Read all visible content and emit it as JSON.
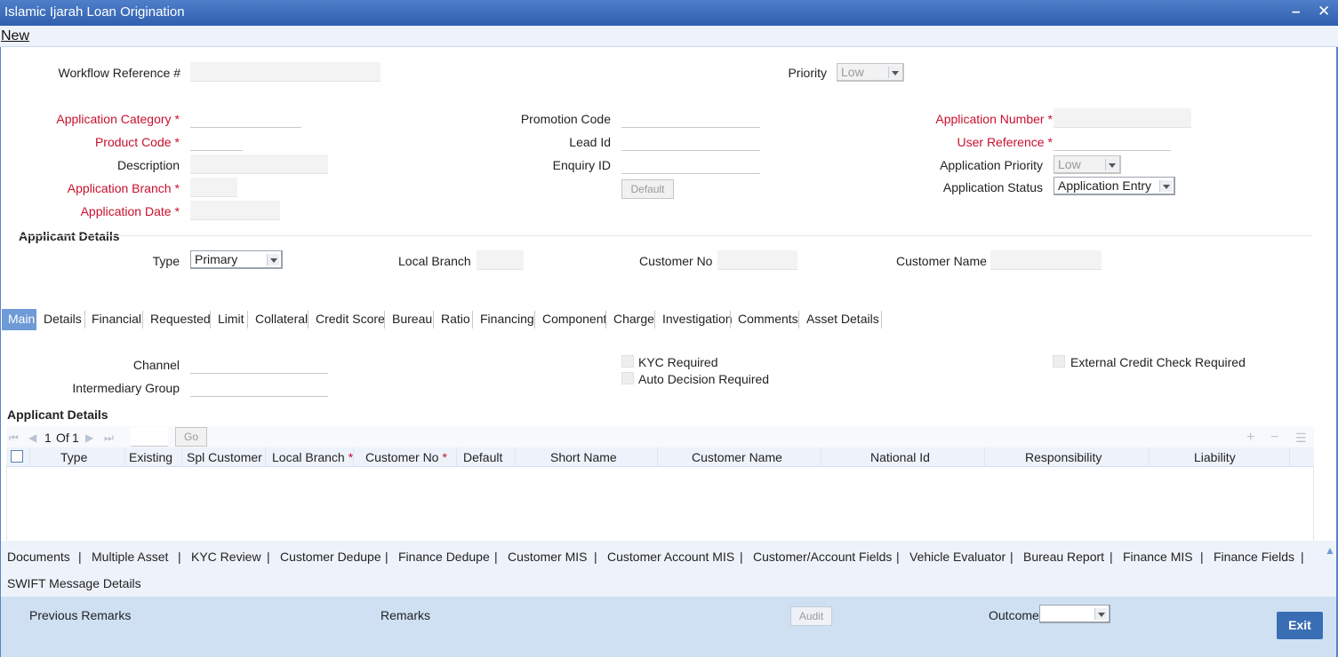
{
  "window": {
    "title": "Islamic Ijarah Loan Origination",
    "minimize": "–",
    "close": "✕"
  },
  "menu": {
    "new": "New"
  },
  "header": {
    "workflow_ref_label": "Workflow Reference #",
    "workflow_ref_value": "",
    "priority_label": "Priority",
    "priority_value": "Low"
  },
  "form": {
    "application_category_label": "Application Category",
    "product_code_label": "Product Code",
    "description_label": "Description",
    "application_branch_label": "Application Branch",
    "application_date_label": "Application Date",
    "promotion_code_label": "Promotion Code",
    "lead_id_label": "Lead Id",
    "enquiry_id_label": "Enquiry ID",
    "default_button": "Default",
    "application_number_label": "Application Number",
    "user_reference_label": "User Reference",
    "application_priority_label": "Application Priority",
    "application_priority_value": "Low",
    "application_status_label": "Application Status",
    "application_status_value": "Application Entry",
    "required_mark": "*"
  },
  "applicant": {
    "section_title": "Applicant Details",
    "type_label": "Type",
    "type_value": "Primary",
    "local_branch_label": "Local Branch",
    "customer_no_label": "Customer No",
    "customer_name_label": "Customer Name"
  },
  "tabs": [
    "Main",
    "Details",
    "Financial",
    "Requested",
    "Limit",
    "Collateral",
    "Credit Score",
    "Bureau",
    "Ratio",
    "Financing",
    "Component",
    "Charge",
    "Investigation",
    "Comments",
    "Asset Details"
  ],
  "main": {
    "channel_label": "Channel",
    "intermediary_group_label": "Intermediary Group",
    "kyc_required_label": "KYC Required",
    "auto_decision_label": "Auto Decision Required",
    "external_credit_label": "External Credit Check Required",
    "applicant_details_title": "Applicant Details"
  },
  "grid": {
    "page_current": "1",
    "page_of": "Of",
    "page_total": "1",
    "go_button": "Go",
    "columns": [
      "Type",
      "Existing",
      "Spl Customer",
      "Local Branch",
      "Customer No",
      "Default",
      "Short Name",
      "Customer Name",
      "National Id",
      "Responsibility",
      "Liability"
    ]
  },
  "links": [
    "Documents",
    "Multiple Asset",
    "KYC Review",
    "Customer Dedupe",
    "Finance Dedupe",
    "Customer MIS",
    "Customer Account MIS",
    "Customer/Account Fields",
    "Vehicle Evaluator",
    "Bureau Report",
    "Finance MIS",
    "Finance Fields",
    "SWIFT Message Details"
  ],
  "footer": {
    "previous_remarks_label": "Previous Remarks",
    "remarks_label": "Remarks",
    "audit_button": "Audit",
    "outcome_label": "Outcome",
    "outcome_value": "",
    "exit_button": "Exit"
  }
}
